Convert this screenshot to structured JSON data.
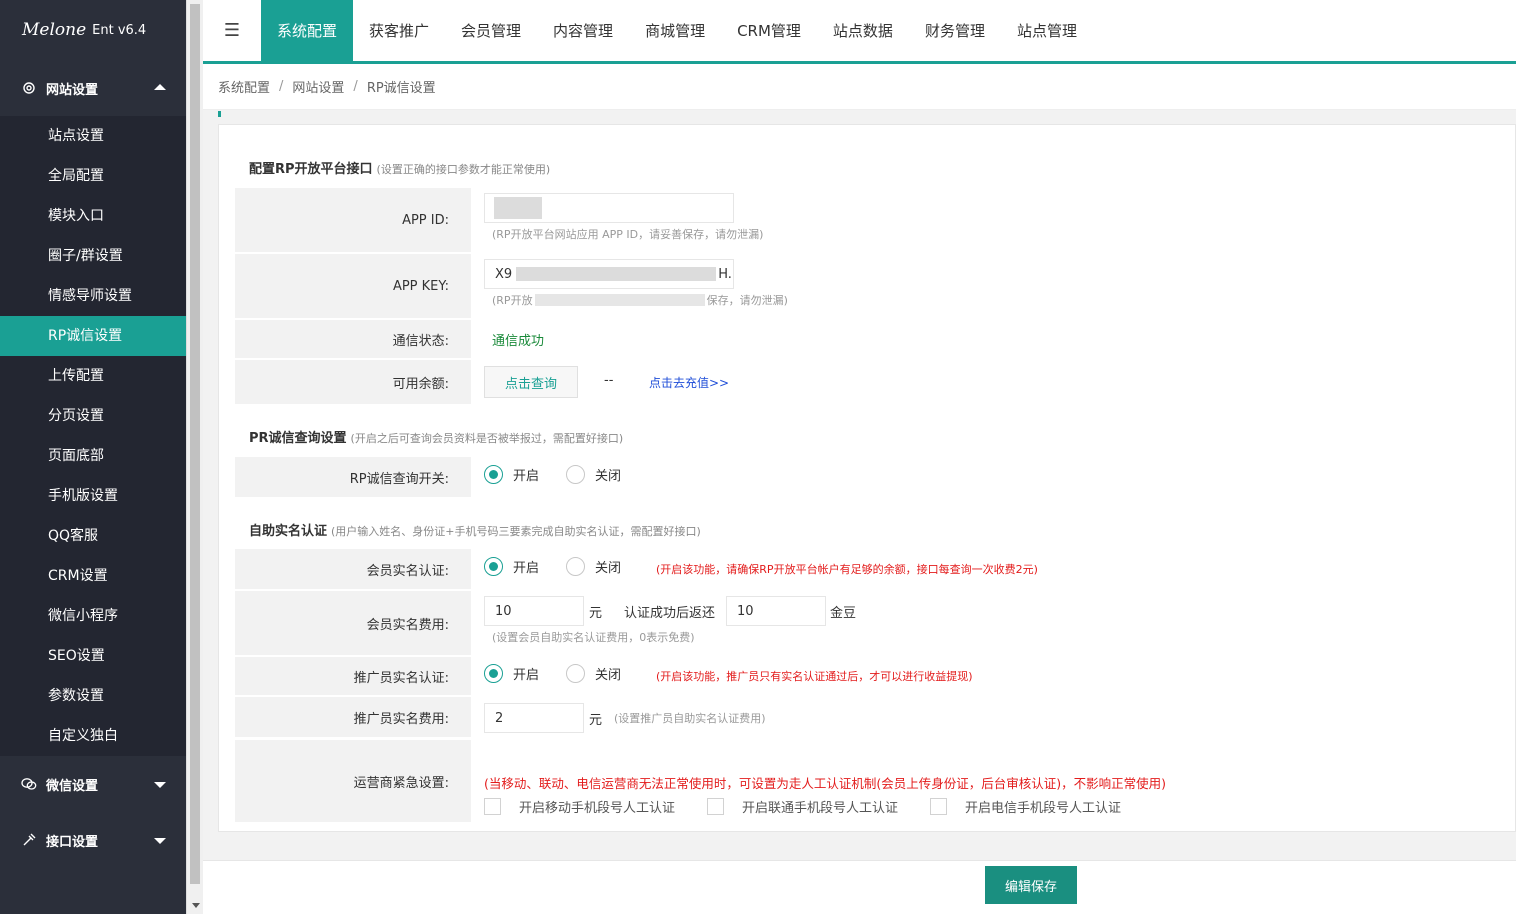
{
  "brand": {
    "logo_text": "Melone",
    "version": "Ent v6.4"
  },
  "sidebar": {
    "groups": [
      {
        "label": "网站设置",
        "icon": "gear-icon",
        "expanded": true
      },
      {
        "label": "微信设置",
        "icon": "wechat-icon",
        "expanded": false
      },
      {
        "label": "接口设置",
        "icon": "plug-icon",
        "expanded": false
      }
    ],
    "items": [
      "站点设置",
      "全局配置",
      "模块入口",
      "圈子/群设置",
      "情感导师设置",
      "RP诚信设置",
      "上传配置",
      "分页设置",
      "页面底部",
      "手机版设置",
      "QQ客服",
      "CRM设置",
      "微信小程序",
      "SEO设置",
      "参数设置",
      "自定义独白"
    ],
    "active_item": "RP诚信设置"
  },
  "topnav": {
    "menu_icon": "☰",
    "tabs": [
      "系统配置",
      "获客推广",
      "会员管理",
      "内容管理",
      "商城管理",
      "CRM管理",
      "站点数据",
      "财务管理",
      "站点管理"
    ],
    "active": "系统配置"
  },
  "breadcrumb": [
    "系统配置",
    "网站设置",
    "RP诚信设置"
  ],
  "breadcrumb_sep": "/",
  "sections": {
    "api": {
      "title": "配置RP开放平台接口",
      "hint": "(设置正确的接口参数才能正常使用)"
    },
    "query": {
      "title": "PR诚信查询设置",
      "hint": "(开启之后可查询会员资料是否被举报过，需配置好接口)"
    },
    "realname": {
      "title": "自助实名认证",
      "hint": "(用户输入姓名、身份证+手机号码三要素完成自助实名认证，需配置好接口)"
    }
  },
  "fields": {
    "app_id": {
      "label": "APP ID:",
      "help": "(RP开放平台网站应用 APP ID，请妥善保存，请勿泄漏)"
    },
    "app_key": {
      "label": "APP KEY:",
      "value_prefix": "X9",
      "value_suffix": "H.",
      "help_prefix": "(RP开放",
      "help_suffix": "保存，请勿泄漏)"
    },
    "status": {
      "label": "通信状态:",
      "value": "通信成功"
    },
    "balance": {
      "label": "可用余额:",
      "query_button": "点击查询",
      "value": "--",
      "recharge_link": "点击去充值>>"
    },
    "query_switch": {
      "label": "RP诚信查询开关:",
      "on": "开启",
      "off": "关闭",
      "selected": "开启"
    },
    "member_auth": {
      "label": "会员实名认证:",
      "on": "开启",
      "off": "关闭",
      "selected": "开启",
      "warning": "(开启该功能，请确保RP开放平台帐户有足够的余额，接口每查询一次收费2元)"
    },
    "member_fee": {
      "label": "会员实名费用:",
      "value": "10",
      "unit": "元",
      "return_label": "认证成功后返还",
      "return_value": "10",
      "return_unit": "金豆",
      "help": "(设置会员自助实名认证费用，0表示免费)"
    },
    "promoter_auth": {
      "label": "推广员实名认证:",
      "on": "开启",
      "off": "关闭",
      "selected": "开启",
      "warning": "(开启该功能，推广员只有实名认证通过后，才可以进行收益提现)"
    },
    "promoter_fee": {
      "label": "推广员实名费用:",
      "value": "2",
      "unit": "元",
      "help": "(设置推广员自助实名认证费用)"
    },
    "carrier": {
      "label": "运营商紧急设置:",
      "warning": "(当移动、联动、电信运营商无法正常使用时，可设置为走人工认证机制(会员上传身份证，后台审核认证)，不影响正常使用)",
      "options": [
        "开启移动手机段号人工认证",
        "开启联通手机段号人工认证",
        "开启电信手机段号人工认证"
      ]
    }
  },
  "save_button": "编辑保存",
  "colors": {
    "accent": "#1aa094",
    "sidebar_bg": "#2b2f3a",
    "warning": "#e31c1c",
    "success": "#1a8a3a"
  }
}
